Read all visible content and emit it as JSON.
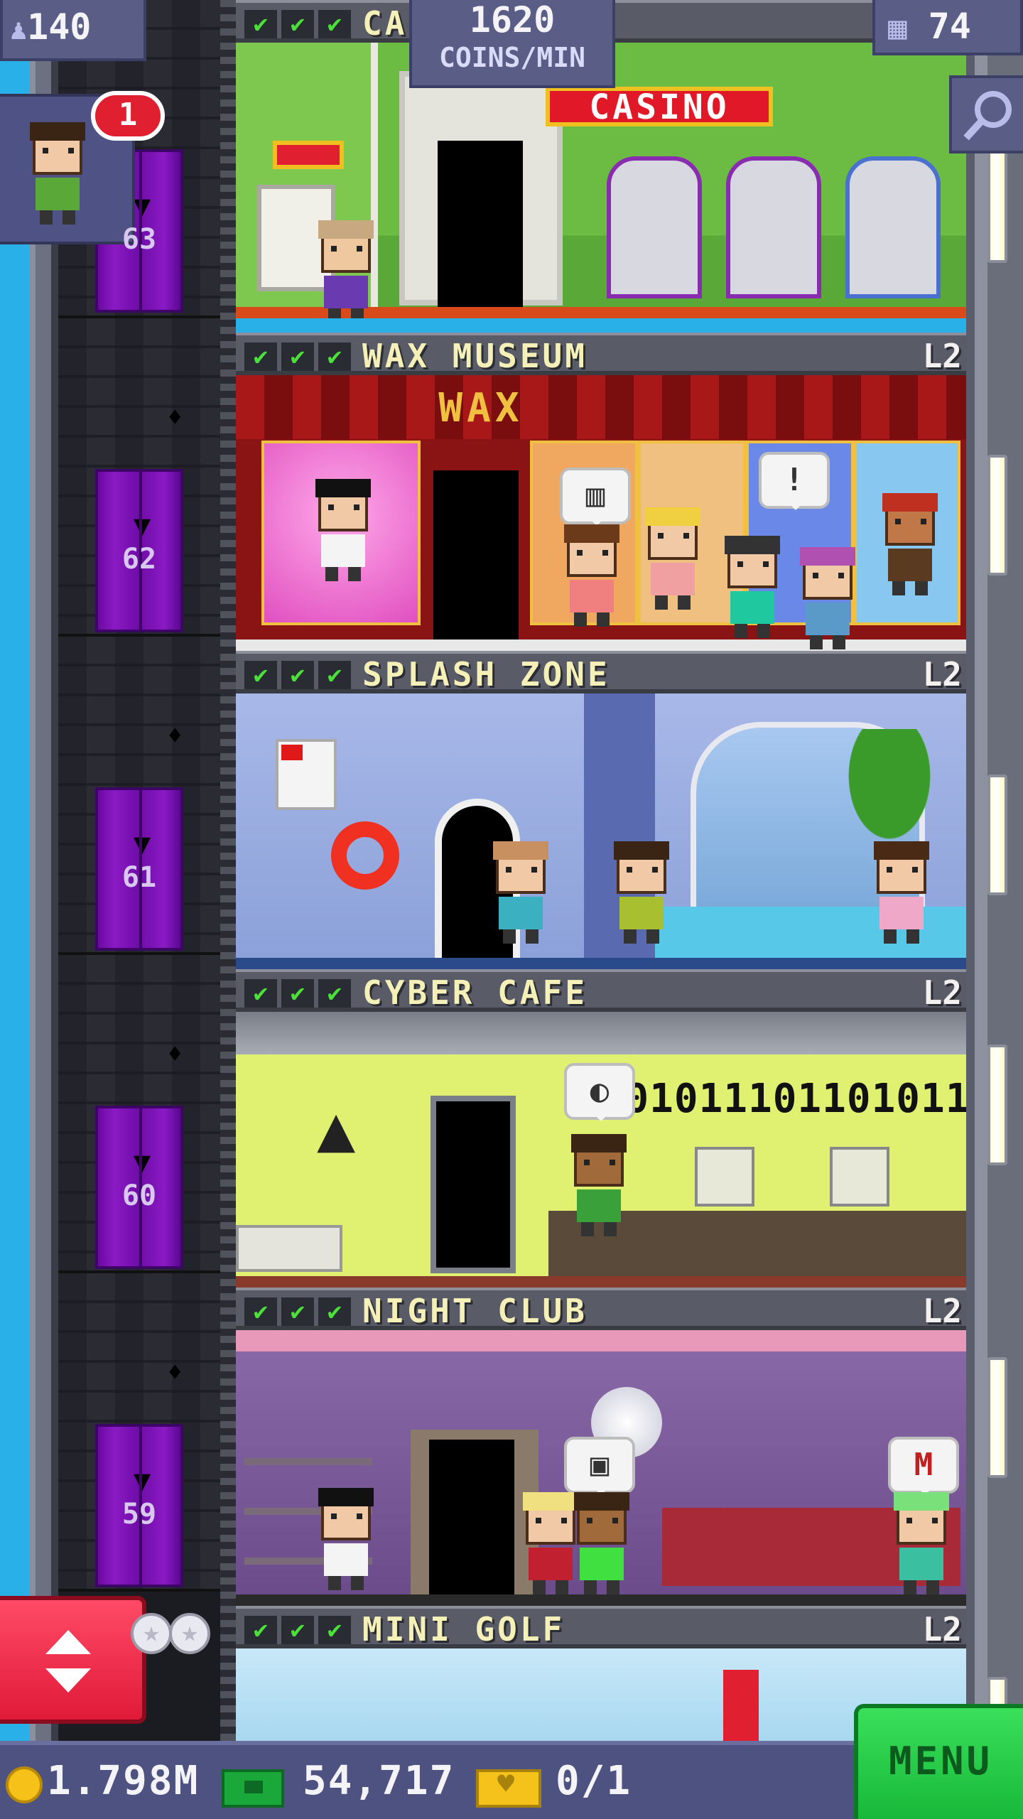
{
  "hud": {
    "population": "140",
    "coins_per_min_value": "1620",
    "coins_per_min_label": "COINS/MIN",
    "floor_count": "74",
    "visitor_badge": "1"
  },
  "floors": [
    {
      "name": "CASINO",
      "level": "",
      "checks": [
        "✔",
        "✔",
        "✔"
      ],
      "sign": "CASINO",
      "elevator_floor": "63"
    },
    {
      "name": "WAX MUSEUM",
      "level": "L2",
      "checks": [
        "✔",
        "✔",
        "✔"
      ],
      "sign": "WAX",
      "elevator_floor": "62"
    },
    {
      "name": "SPLASH ZONE",
      "level": "L2",
      "checks": [
        "✔",
        "✔",
        "✔"
      ],
      "elevator_floor": "61"
    },
    {
      "name": "CYBER CAFE",
      "level": "L2",
      "checks": [
        "✔",
        "✔",
        "✔"
      ],
      "binary": "0101011101101011",
      "elevator_floor": "60"
    },
    {
      "name": "NIGHT CLUB",
      "level": "L2",
      "checks": [
        "✔",
        "✔",
        "✔"
      ],
      "elevator_floor": "59"
    },
    {
      "name": "MINI GOLF",
      "level": "L2",
      "checks": [
        "✔",
        "✔",
        "✔"
      ]
    }
  ],
  "bottom_bar": {
    "coins": "1.798M",
    "bux": "54,717",
    "tickets": "0/1",
    "menu_label": "MENU"
  },
  "colors": {
    "elevator": "#7a12b6",
    "check": "#4ce03a",
    "menu": "#22c846",
    "elevator_button": "#f0304e"
  },
  "icons": [
    "person-icon",
    "building-icon",
    "search-icon",
    "coin-icon",
    "bux-icon",
    "ticket-icon",
    "elevator-arrows-icon",
    "bat-icon"
  ]
}
